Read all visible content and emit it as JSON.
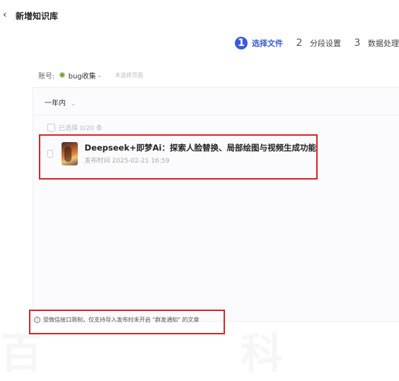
{
  "header": {
    "back_icon": "chevron-left-icon",
    "title": "新增知识库"
  },
  "steps": [
    {
      "num": "1",
      "label": "选择文件",
      "active": true
    },
    {
      "num": "2",
      "label": "分段设置",
      "active": false
    },
    {
      "num": "3",
      "label": "数据处理",
      "active": false
    }
  ],
  "account": {
    "label": "账号:",
    "icon": "bug-icon",
    "name": "bug收集",
    "page_placeholder": "未选择页面"
  },
  "filter": {
    "value": "一年内"
  },
  "selection": {
    "text": "已选择 0/20 条"
  },
  "articles": [
    {
      "title": "Deepseek+即梦Ai：探索人脸替换、局部绘图与视频生成功能",
      "meta": "发布时间 2025-02-21 16:59"
    }
  ],
  "notice": {
    "text": "受微信接口限制，仅支持导入发布时未开启 \"群发通知\" 的文章"
  },
  "colors": {
    "accent": "#3a5bd9",
    "highlight": "#d8232a"
  }
}
